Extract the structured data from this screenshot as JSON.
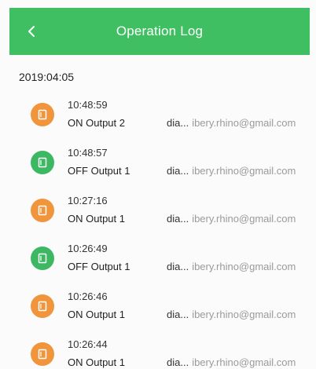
{
  "header": {
    "title": "Operation Log",
    "back_icon": "chevron-left-icon",
    "color": "#3fbf62"
  },
  "date": "2019:04:05",
  "colors": {
    "on": "#f0953b",
    "off": "#3cb862"
  },
  "entries": [
    {
      "time": "10:48:59",
      "action": "ON Output 2",
      "user_short": "dia...",
      "email": "ibery.rhino@gmail.com",
      "state": "on",
      "icon": "output-on-icon"
    },
    {
      "time": "10:48:57",
      "action": "OFF Output 1",
      "user_short": "dia...",
      "email": "ibery.rhino@gmail.com",
      "state": "off",
      "icon": "output-off-icon"
    },
    {
      "time": "10:27:16",
      "action": "ON Output 1",
      "user_short": "dia...",
      "email": "ibery.rhino@gmail.com",
      "state": "on",
      "icon": "output-on-icon"
    },
    {
      "time": "10:26:49",
      "action": "OFF Output 1",
      "user_short": "dia...",
      "email": "ibery.rhino@gmail.com",
      "state": "off",
      "icon": "output-off-icon"
    },
    {
      "time": "10:26:46",
      "action": "ON Output 1",
      "user_short": "dia...",
      "email": "ibery.rhino@gmail.com",
      "state": "on",
      "icon": "output-on-icon"
    },
    {
      "time": "10:26:44",
      "action": "ON Output 1",
      "user_short": "dia...",
      "email": "ibery.rhino@gmail.com",
      "state": "on",
      "icon": "output-on-icon"
    }
  ]
}
